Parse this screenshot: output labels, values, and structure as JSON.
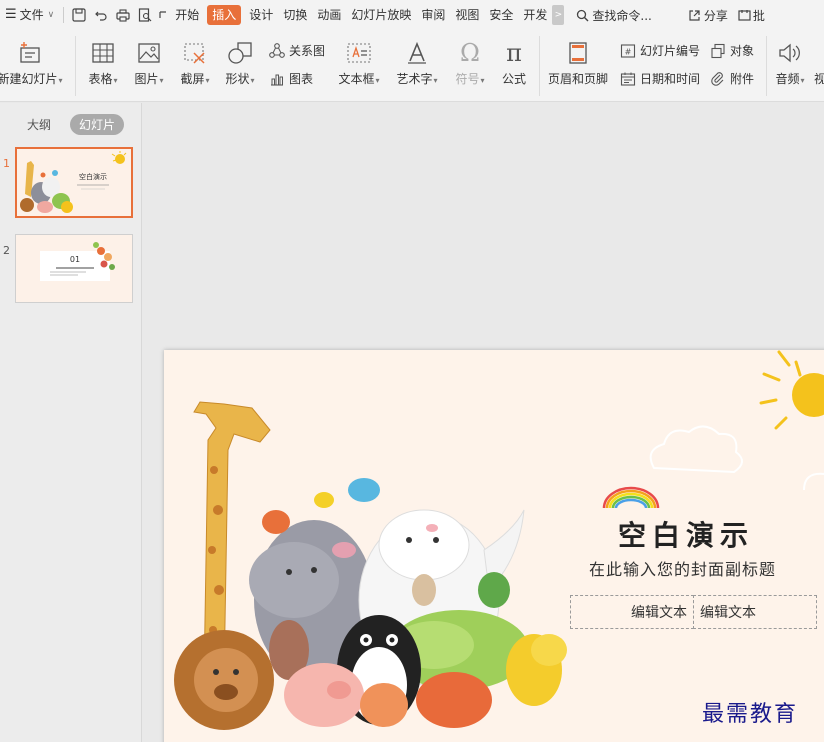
{
  "menubar": {
    "file": "文件",
    "tabs": [
      "开始",
      "插入",
      "设计",
      "切换",
      "动画",
      "幻灯片放映",
      "审阅",
      "视图",
      "安全",
      "开发"
    ],
    "active_tab": "插入",
    "search": "查找命令...",
    "share": "分享",
    "more": "批"
  },
  "ribbon": {
    "new_slide": "新建幻灯片",
    "table": "表格",
    "picture": "图片",
    "screenshot": "截屏",
    "shape": "形状",
    "smartart": "关系图",
    "chart": "图表",
    "textbox": "文本框",
    "wordart": "艺术字",
    "symbol": "符号",
    "formula": "公式",
    "header_footer": "页眉和页脚",
    "slide_number": "幻灯片编号",
    "datetime": "日期和时间",
    "object": "对象",
    "attachment": "附件",
    "audio": "音频",
    "video": "视"
  },
  "panel": {
    "tab_outline": "大纲",
    "tab_slides": "幻灯片",
    "slide_numbers": [
      "1",
      "2"
    ],
    "thumb2_num": "01"
  },
  "slide": {
    "title": "空白演示",
    "subtitle": "在此输入您的封面副标题",
    "box1": "编辑文本",
    "box2": "编辑文本"
  },
  "watermark": "最需教育",
  "colors": {
    "accent": "#e8703a",
    "slide_bg": "#fef3ea",
    "sun": "#f4c21c"
  }
}
